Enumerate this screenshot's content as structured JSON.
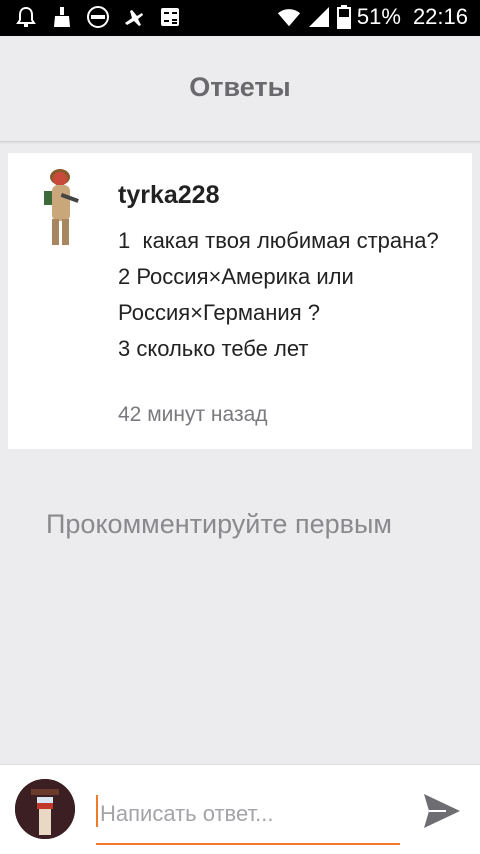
{
  "status_bar": {
    "battery": "51%",
    "time": "22:16",
    "icons": [
      "alarm-icon",
      "broom-icon",
      "free-badge-icon",
      "airplane-icon",
      "calculator-icon",
      "wifi-icon",
      "signal-icon",
      "battery-icon"
    ]
  },
  "header": {
    "title": "Ответы"
  },
  "question": {
    "author": "tyrka228",
    "text": "1  какая твоя любимая страна?\n2 Россия×Америка или Россия×Германия ?\n3 сколько тебе лет",
    "time": "42 минут назад"
  },
  "comments": {
    "empty_text": "Прокомментируйте первым"
  },
  "reply": {
    "placeholder": "Написать ответ...",
    "value": ""
  },
  "colors": {
    "accent": "#f07a2a",
    "background": "#ececee",
    "title": "#6a6a6e"
  }
}
